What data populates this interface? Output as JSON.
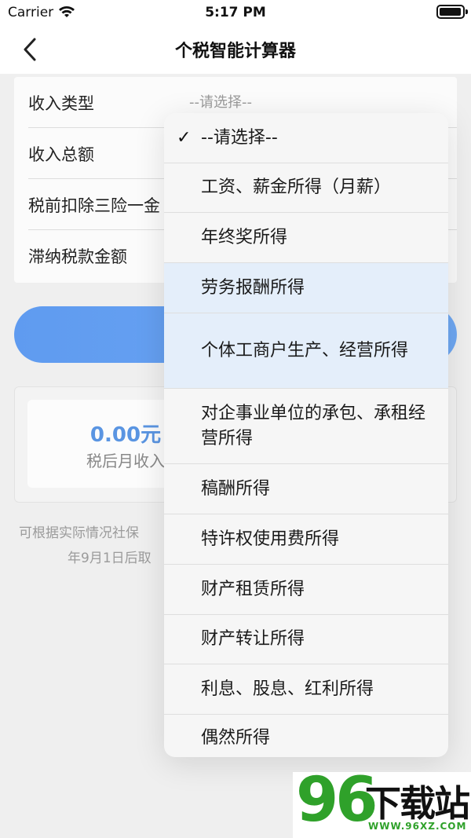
{
  "status_bar": {
    "carrier": "Carrier",
    "time": "5:17 PM"
  },
  "nav": {
    "title": "个税智能计算器"
  },
  "form": {
    "rows": [
      {
        "label": "收入类型",
        "value": "--请选择--"
      },
      {
        "label": "收入总额"
      },
      {
        "label": "税前扣除三险一金"
      },
      {
        "label": "滞纳税款金额"
      }
    ]
  },
  "result": {
    "value": "0.00元",
    "label": "税后月收入"
  },
  "notes": {
    "line1": "可根据实际情况社保",
    "line2": "年9月1日后取"
  },
  "dropdown": {
    "selected_index": 0,
    "options": [
      "--请选择--",
      "工资、薪金所得（月薪）",
      "年终奖所得",
      "劳务报酬所得",
      "个体工商户生产、经营所得",
      "对企事业单位的承包、承租经营所得",
      "稿酬所得",
      "特许权使用费所得",
      "财产租赁所得",
      "财产转让所得",
      "利息、股息、红利所得",
      "偶然所得"
    ]
  },
  "watermark": {
    "number": "96",
    "text": "下载站",
    "url": "WWW.96XZ.COM"
  },
  "colors": {
    "accent": "#5f9bf0",
    "result_value": "#5a95e2",
    "watermark_green": "#2fa12a"
  }
}
